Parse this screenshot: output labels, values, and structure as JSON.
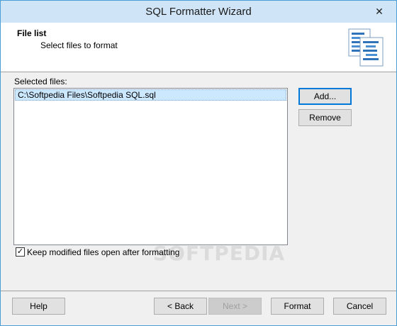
{
  "window": {
    "title": "SQL Formatter Wizard",
    "close_glyph": "✕"
  },
  "header": {
    "title": "File list",
    "subtitle": "Select files to format",
    "icon": "document-list-icon"
  },
  "files": {
    "label": "Selected files:",
    "items": [
      "C:\\Softpedia Files\\Softpedia SQL.sql"
    ]
  },
  "buttons": {
    "add": "Add...",
    "remove": "Remove",
    "help": "Help",
    "back": "< Back",
    "next": "Next >",
    "format": "Format",
    "cancel": "Cancel"
  },
  "options": {
    "keep_open_label": "Keep modified files open after formatting",
    "keep_open_checked": true,
    "check_glyph": "✓"
  },
  "watermark": "SOFTPEDIA",
  "colors": {
    "accent": "#0078d7",
    "selection": "#cce8ff",
    "titlebar": "#cfe4f6"
  }
}
